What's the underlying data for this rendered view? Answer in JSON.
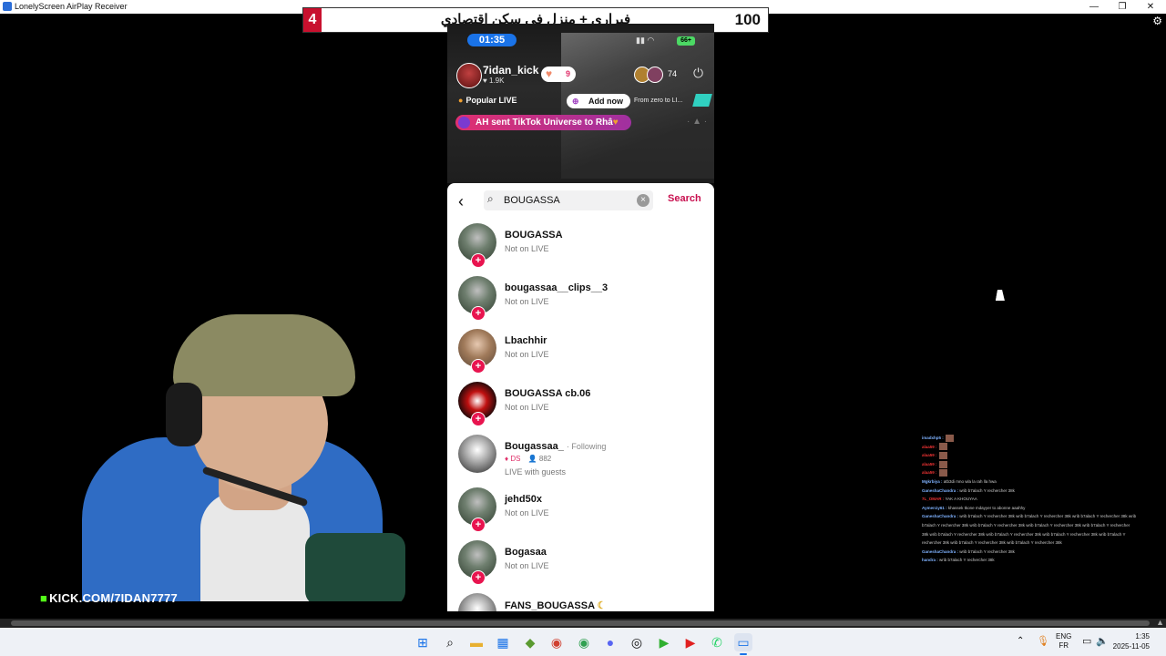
{
  "window": {
    "title": "LonelyScreen AirPlay Receiver",
    "minimize": "—",
    "restore": "❐",
    "close": "✕",
    "settings_icon": "gear-icon"
  },
  "banner": {
    "left_number": "4",
    "text": "فيراري + منزل في سكن اقتصادي",
    "right_number": "100"
  },
  "phone": {
    "status": {
      "time": "01:35",
      "battery": "66+"
    },
    "host": {
      "name": "7idan_kick",
      "likes": "1.9K"
    },
    "gift_count": "9",
    "viewer_count": "74",
    "popular_live": "Popular LIVE",
    "add_now": "Add now",
    "from_zero": "From zero to LI...",
    "gift_banner": "AH sent TikTok Universe to Rhâ",
    "search": {
      "query": "BOUGASSA",
      "button": "Search"
    },
    "results": [
      {
        "name": "BOUGASSA",
        "status": "Not on LIVE"
      },
      {
        "name": "bougassaa__clips__3",
        "status": "Not on LIVE"
      },
      {
        "name": "Lbachhir",
        "status": "Not on LIVE"
      },
      {
        "name": "BOUGASSA cb.06",
        "status": "Not on LIVE"
      },
      {
        "name": "Bougassaa_",
        "following": "· Following",
        "gems": "DS",
        "viewers": "882",
        "status": "LIVE with guests"
      },
      {
        "name": "jehd50x",
        "status": "Not on LIVE"
      },
      {
        "name": "Bogasaa",
        "status": "Not on LIVE"
      },
      {
        "name": "FANS_BOUGASSA",
        "status": ""
      }
    ]
  },
  "kick": {
    "url": "KICK.COM/7IDAN7777"
  },
  "chat": [
    {
      "user": "imadxhp5 :",
      "msg": ""
    },
    {
      "user": "alaa59 :",
      "msg": ""
    },
    {
      "user": "alaa59 :",
      "msg": ""
    },
    {
      "user": "alaa59 :",
      "msg": ""
    },
    {
      "user": "alaa59 :",
      "msg": ""
    },
    {
      "user": "Mgkrbiya :",
      "msg": "atb3di mno wla la rah lla hwa"
    },
    {
      "user": "GaneshaChandra :",
      "msg": "wrib b7alach Y rechercher 38k"
    },
    {
      "user": "7L_OMAR :",
      "msg": "YAK A KHOUYAA"
    },
    {
      "user": "Aymen1y61 :",
      "msg": "khassek tkone mdayyer to abonne aaahhy"
    },
    {
      "user": "GaneshaChandra :",
      "msg": "wrib b7alach Y rechercher 38k wrib b7alach Y rechercher 38k wrib b7alach Y rechercher 38k wrib"
    },
    {
      "user": "",
      "msg": "b7alach Y rechercher 38k wrib b7alach Y rechercher 38k wrib b7alach Y rechercher 38k wrib b7alach Y rechercher"
    },
    {
      "user": "",
      "msg": "38k wrib b7alach Y rechercher 38k wrib b7alach Y rechercher 38k wrib b7alach Y rechercher 38k wrib b7alach Y"
    },
    {
      "user": "",
      "msg": "rechercher 38k wrib b7alach Y rechercher 38k wrib b7alach Y rechercher 38k"
    },
    {
      "user": "GaneshaChandra :",
      "msg": "wrib b7alach Y rechercher 38k"
    },
    {
      "user": "handra :",
      "msg": "wrib b7alach Y rechercher 38k"
    }
  ],
  "taskbar": {
    "lang_top": "ENG",
    "lang_bottom": "FR",
    "time": "1:35",
    "date": "2025-11-05"
  },
  "colors": {
    "tiktok_red": "#e8144f",
    "search_accent": "#c8104f",
    "kick_green": "#53fc18",
    "banner_red": "#c8102e"
  }
}
